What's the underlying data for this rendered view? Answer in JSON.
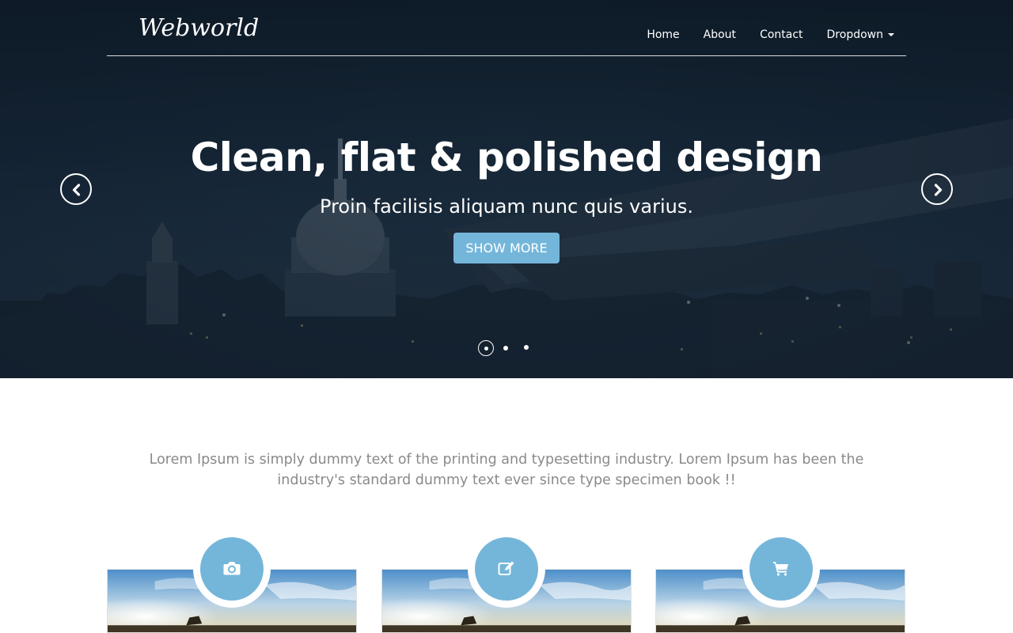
{
  "header": {
    "brand": "Webworld",
    "nav": [
      {
        "label": "Home"
      },
      {
        "label": "About"
      },
      {
        "label": "Contact"
      },
      {
        "label": "Dropdown"
      }
    ]
  },
  "hero": {
    "title": "Clean, flat & polished design",
    "subtitle": "Proin facilisis aliquam nunc quis varius.",
    "button_label": "SHOW MORE",
    "slide_count": 3,
    "active_slide": 1,
    "accent_color": "#74b6d9"
  },
  "intro": {
    "text": "Lorem Ipsum is simply dummy text of the printing and typesetting industry. Lorem Ipsum has been the industry's standard dummy text ever since type specimen book !!"
  },
  "features": [
    {
      "icon": "camera-icon"
    },
    {
      "icon": "edit-icon"
    },
    {
      "icon": "shopping-cart-icon"
    }
  ]
}
